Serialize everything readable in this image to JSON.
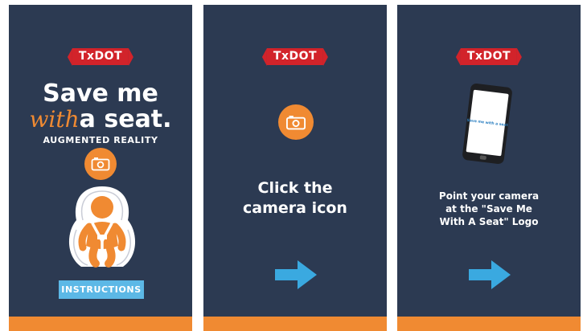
{
  "panels": {
    "splash": {
      "logo": "TxDOT",
      "title_part1": "Save me",
      "title_with": "with",
      "title_part2": "a seat.",
      "subtitle": "AUGMENTED REALITY",
      "button": "INSTRUCTIONS"
    },
    "step1": {
      "logo": "TxDOT",
      "line1": "Click the",
      "line2": "camera icon"
    },
    "step2": {
      "logo": "TxDOT",
      "phone_logo": "Save me with a seat",
      "line1": "Point your camera",
      "line2": "at the \"Save Me",
      "line3": "With A Seat\" Logo"
    }
  },
  "icons": [
    "camera-icon",
    "car-seat-baby-illustration",
    "arrow-right-icon",
    "phone-illustration"
  ],
  "colors": {
    "background": "#2c3a52",
    "accent_orange": "#f08a32",
    "logo_red": "#d2232a",
    "button_blue": "#5cb8e6",
    "arrow_blue": "#3aa9e0"
  }
}
